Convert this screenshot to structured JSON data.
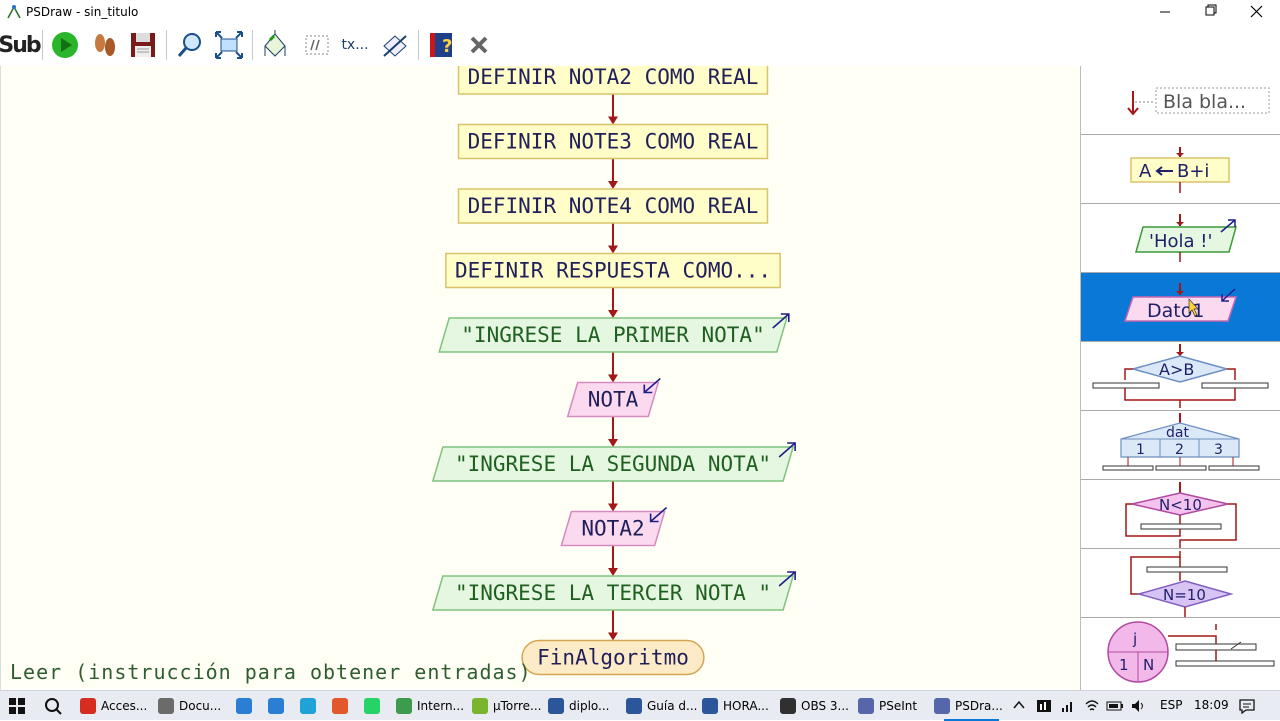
{
  "window": {
    "title": "PSDraw - sin_titulo"
  },
  "toolbar": {
    "sub_label": "Sub",
    "tx_label": "tx..."
  },
  "flow": {
    "blocks": [
      {
        "type": "process",
        "text": "DEFINIR NOTA2 COMO REAL"
      },
      {
        "type": "process",
        "text": "DEFINIR NOTE3 COMO REAL"
      },
      {
        "type": "process",
        "text": "DEFINIR NOTE4 COMO REAL"
      },
      {
        "type": "process",
        "text": "DEFINIR RESPUESTA COMO..."
      },
      {
        "type": "output",
        "text": "\"INGRESE LA PRIMER NOTA\""
      },
      {
        "type": "input",
        "text": "NOTA"
      },
      {
        "type": "output",
        "text": "\"INGRESE LA SEGUNDA NOTA\""
      },
      {
        "type": "input",
        "text": "NOTA2"
      },
      {
        "type": "output",
        "text": "\"INGRESE LA TERCER NOTA \""
      },
      {
        "type": "end",
        "text": "FinAlgoritmo"
      }
    ]
  },
  "status": {
    "text": "Leer (instrucción para obtener entradas)"
  },
  "palette": {
    "comment": "Bla bla...",
    "assign_left": "A",
    "assign_right": "B+i",
    "write": "'Hola !'",
    "read": "Dato1",
    "if_cond": "A>B",
    "switch_var": "dat",
    "switch_opts": [
      "1",
      "2",
      "3"
    ],
    "while_cond": "N<10",
    "repeat_cond": "N=10",
    "for_var": "j",
    "for_1": "1",
    "for_n": "N"
  },
  "taskbar": {
    "items": [
      {
        "label": "Acces...",
        "color": "#d62d20"
      },
      {
        "label": "Docu...",
        "color": "#6b6b6b"
      },
      {
        "label": "",
        "color": "#2a7fd4"
      },
      {
        "label": "",
        "color": "#2a7fd4"
      },
      {
        "label": "",
        "color": "#1fa3d6"
      },
      {
        "label": "",
        "color": "#e2572c"
      },
      {
        "label": "",
        "color": "#25d366"
      },
      {
        "label": "Intern...",
        "color": "#3c9b4c"
      },
      {
        "label": "µTorre...",
        "color": "#7bb52f"
      },
      {
        "label": "diplo...",
        "color": "#2b579a"
      },
      {
        "label": "Guía d...",
        "color": "#2b579a"
      },
      {
        "label": "HORA...",
        "color": "#2b579a"
      },
      {
        "label": "OBS 3...",
        "color": "#303030"
      },
      {
        "label": "PSeInt",
        "color": "#5566aa"
      },
      {
        "label": "PSDra...",
        "color": "#5566aa"
      }
    ],
    "lang": "ESP",
    "time": "18:09"
  },
  "colors": {
    "process_fill": "#fffdc8",
    "process_stroke": "#d9c36a",
    "output_fill": "#e5f7e0",
    "output_stroke": "#7fc37f",
    "input_fill": "#fbdaf0",
    "input_stroke": "#d58ac0",
    "end_fill": "#fdebc8",
    "end_stroke": "#d4a553",
    "arrow": "#a01818",
    "selected": "#0a78d7"
  }
}
